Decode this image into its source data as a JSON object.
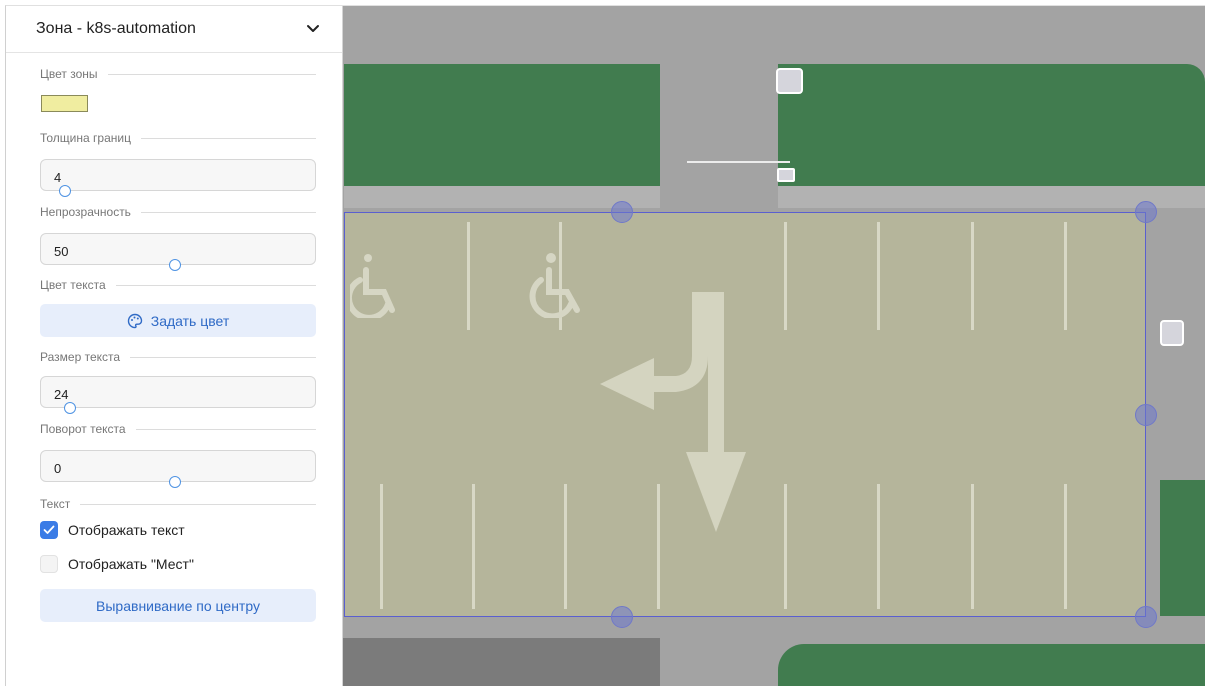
{
  "panel": {
    "title": "Зона - k8s-automation",
    "zone_color_label": "Цвет зоны",
    "zone_color": "#f0eda0",
    "border_width_label": "Толщина границ",
    "border_width_value": "4",
    "opacity_label": "Непрозрачность",
    "opacity_value": "50",
    "text_color_label": "Цвет текста",
    "set_color_button": "Задать цвет",
    "text_size_label": "Размер текста",
    "text_size_value": "24",
    "text_rotation_label": "Поворот текста",
    "text_rotation_value": "0",
    "text_section_label": "Текст",
    "show_text_label": "Отображать текст",
    "show_text_checked": true,
    "show_places_label": "Отображать \"Мест\"",
    "show_places_checked": false,
    "align_center_button": "Выравнивание по центру"
  },
  "colors": {
    "accent": "#2f6ac6",
    "grass": "#417c4f",
    "zone_fill": "#b5b59b",
    "zone_border": "#5a5fcf"
  }
}
